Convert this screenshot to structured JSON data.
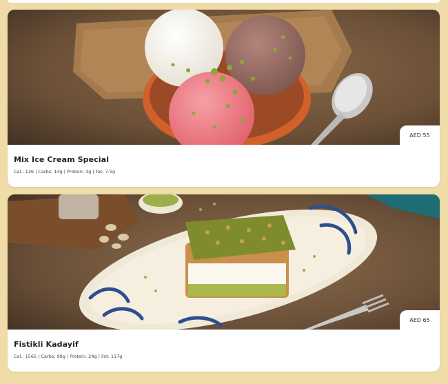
{
  "items": [
    {
      "name": "Mix Ice Cream Special",
      "nutrition": "Cal.: 136 | Carbs: 14g | Protein: 3g | Fat: 7.5g",
      "price": "AED 55"
    },
    {
      "name": "Fistikli Kadayif",
      "nutrition": "Cal.: 1565 | Carbs: 99g | Protein: 24g | Fat: 117g",
      "price": "AED 65"
    }
  ],
  "colors": {
    "page_background": "#efdca8",
    "card_background": "#ffffff",
    "title_text": "#222222"
  }
}
